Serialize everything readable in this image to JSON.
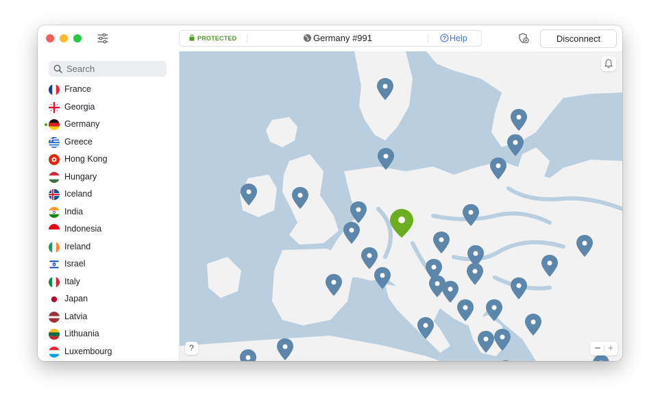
{
  "titlebar": {
    "status": "PROTECTED",
    "server": "Germany #991",
    "help": "Help",
    "disconnect": "Disconnect"
  },
  "search": {
    "placeholder": "Search"
  },
  "countries": [
    {
      "name": "France",
      "flag": "france-flag-icon"
    },
    {
      "name": "Georgia",
      "flag": "georgia-flag-icon"
    },
    {
      "name": "Germany",
      "flag": "germany-flag-icon",
      "connected": true
    },
    {
      "name": "Greece",
      "flag": "greece-flag-icon"
    },
    {
      "name": "Hong Kong",
      "flag": "hong-kong-flag-icon"
    },
    {
      "name": "Hungary",
      "flag": "hungary-flag-icon"
    },
    {
      "name": "Iceland",
      "flag": "iceland-flag-icon"
    },
    {
      "name": "India",
      "flag": "india-flag-icon"
    },
    {
      "name": "Indonesia",
      "flag": "indonesia-flag-icon"
    },
    {
      "name": "Ireland",
      "flag": "ireland-flag-icon"
    },
    {
      "name": "Israel",
      "flag": "israel-flag-icon"
    },
    {
      "name": "Italy",
      "flag": "italy-flag-icon"
    },
    {
      "name": "Japan",
      "flag": "japan-flag-icon"
    },
    {
      "name": "Latvia",
      "flag": "latvia-flag-icon"
    },
    {
      "name": "Lithuania",
      "flag": "lithuania-flag-icon"
    },
    {
      "name": "Luxembourg",
      "flag": "luxembourg-flag-icon"
    }
  ],
  "map": {
    "help_button": "?",
    "zoom_out": "−",
    "zoom_in": "+"
  },
  "colors": {
    "accent_green": "#6aad1f",
    "pin_blue": "#5c87aa",
    "sea": "#b9cfdf",
    "land": "#f2f2f2",
    "help_link": "#3a72e8",
    "protected_text": "#4a9a1c"
  }
}
